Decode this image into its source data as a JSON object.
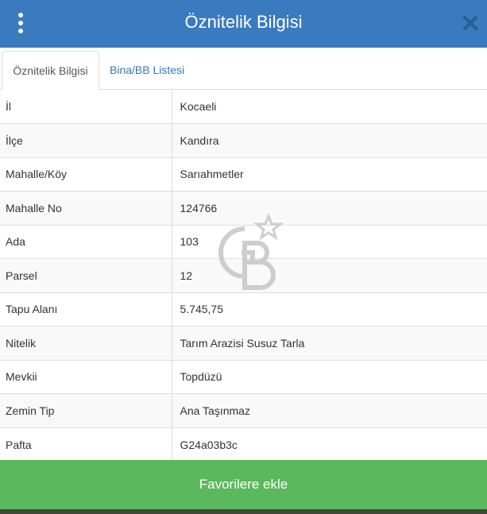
{
  "header": {
    "title": "Öznitelik Bilgisi",
    "menu_icon": "vertical-dots-icon",
    "close_icon": "close-icon"
  },
  "tabs": [
    {
      "label": "Öznitelik Bilgisi",
      "active": true
    },
    {
      "label": "Bina/BB Listesi",
      "active": false
    }
  ],
  "attributes": [
    {
      "key": "İl",
      "value": "Kocaeli"
    },
    {
      "key": "İlçe",
      "value": "Kandıra"
    },
    {
      "key": "Mahalle/Köy",
      "value": "Sarıahmetler"
    },
    {
      "key": "Mahalle No",
      "value": "124766"
    },
    {
      "key": "Ada",
      "value": "103"
    },
    {
      "key": "Parsel",
      "value": "12"
    },
    {
      "key": "Tapu Alanı",
      "value": "5.745,75"
    },
    {
      "key": "Nitelik",
      "value": "Tarım Arazisi Susuz Tarla"
    },
    {
      "key": "Mevkii",
      "value": "Topdüzü"
    },
    {
      "key": "Zemin Tip",
      "value": "Ana Taşınmaz"
    },
    {
      "key": "Pafta",
      "value": "G24a03b3c"
    }
  ],
  "favorite_button": {
    "label": "Favorilere ekle"
  },
  "colors": {
    "header": "#3a7bbf",
    "button": "#5cb85c",
    "link": "#337ab7"
  }
}
